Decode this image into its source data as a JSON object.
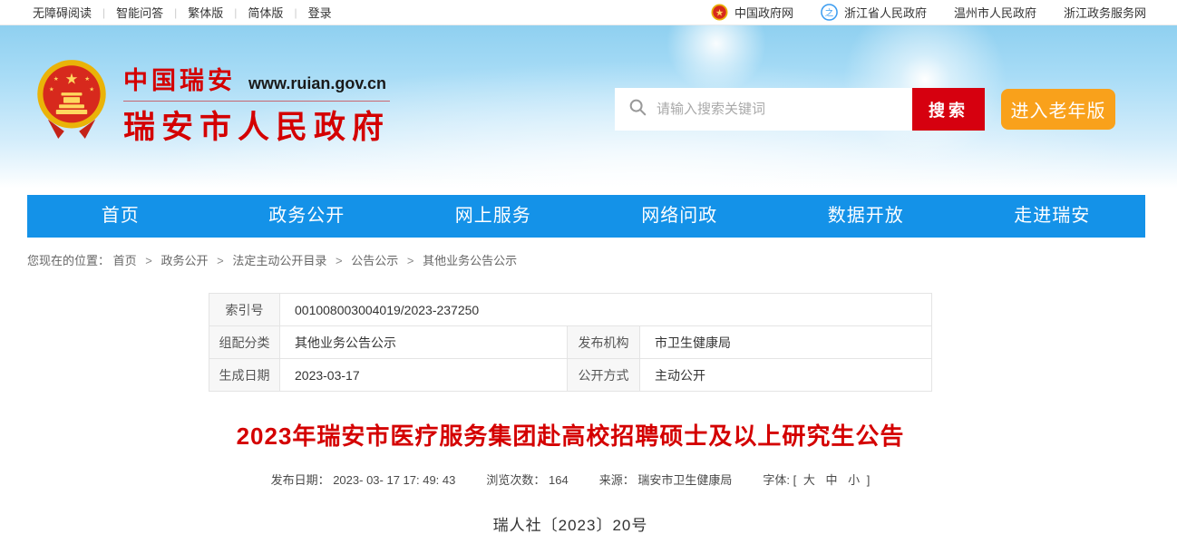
{
  "colors": {
    "nav_blue": "#1492e8",
    "search_red": "#d6000f",
    "elderly_orange": "#f9a11b",
    "title_red": "#d40000",
    "banner_sky_blue": "#8fd0f0"
  },
  "topbar": {
    "left_links": [
      "无障碍阅读",
      "智能问答",
      "繁体版",
      "简体版",
      "登录"
    ],
    "separator": "|",
    "right_links": [
      {
        "icon": "national-emblem-icon",
        "label": "中国政府网"
      },
      {
        "icon": "zhejiang-logo-icon",
        "label": "浙江省人民政府"
      },
      {
        "label": "温州市人民政府"
      },
      {
        "label": "浙江政务服务网"
      }
    ]
  },
  "header": {
    "site_name_small": "中国瑞安",
    "site_url": "www.ruian.gov.cn",
    "site_name_large": "瑞安市人民政府",
    "search": {
      "icon": "search-icon",
      "placeholder": "请输入搜索关键词",
      "button_label": "搜索"
    },
    "elderly_button_label": "进入老年版"
  },
  "nav": {
    "items": [
      "首页",
      "政务公开",
      "网上服务",
      "网络问政",
      "数据开放",
      "走进瑞安"
    ]
  },
  "breadcrumb": {
    "prefix": "您现在的位置：",
    "separator": ">",
    "items": [
      "首页",
      "政务公开",
      "法定主动公开目录",
      "公告公示",
      "其他业务公告公示"
    ]
  },
  "info_table": {
    "row1": {
      "label": "索引号",
      "value": "001008003004019/2023-237250"
    },
    "row2": {
      "label1": "组配分类",
      "value1": "其他业务公告公示",
      "label2": "发布机构",
      "value2": "市卫生健康局"
    },
    "row3": {
      "label1": "生成日期",
      "value1": "2023-03-17",
      "label2": "公开方式",
      "value2": "主动公开"
    }
  },
  "article": {
    "title": "2023年瑞安市医疗服务集团赴高校招聘硕士及以上研究生公告",
    "meta": {
      "publish_label": "发布日期：",
      "publish_value": "2023- 03- 17 17: 49: 43",
      "views_label": "浏览次数：",
      "views_value": "164",
      "source_label": "来源：",
      "source_value": "瑞安市卫生健康局",
      "font_label": "字体:",
      "bracket_open": "[",
      "font_large": "大",
      "font_medium": "中",
      "font_small": "小",
      "bracket_close": "]"
    },
    "doc_number": "瑞人社〔2023〕20号"
  }
}
